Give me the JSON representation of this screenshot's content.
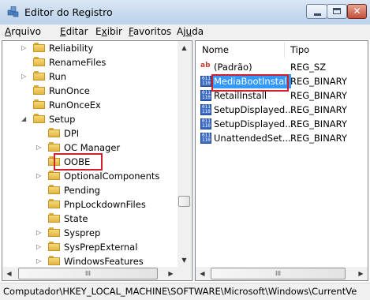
{
  "window": {
    "title": "Editor do Registro"
  },
  "menu": [
    {
      "label": "Arquivo",
      "underline": "A",
      "rest": "rquivo"
    },
    {
      "label": "Editar",
      "underline": "E",
      "rest": "ditar"
    },
    {
      "label": "Exibir",
      "underline": "x",
      "pre": "E",
      "rest": "ibir"
    },
    {
      "label": "Favoritos",
      "underline": "F",
      "rest": "avoritos"
    },
    {
      "label": "Ajuda",
      "underline": "u",
      "pre": "Aj",
      "rest": "da"
    }
  ],
  "tree": [
    {
      "label": "Reliability",
      "expander": "closed"
    },
    {
      "label": "RenameFiles",
      "expander": "none"
    },
    {
      "label": "Run",
      "expander": "closed"
    },
    {
      "label": "RunOnce",
      "expander": "none"
    },
    {
      "label": "RunOnceEx",
      "expander": "none"
    },
    {
      "label": "Setup",
      "expander": "open"
    },
    {
      "label": "DPI",
      "expander": "none"
    },
    {
      "label": "OC Manager",
      "expander": "closed"
    },
    {
      "label": "OOBE",
      "expander": "none",
      "highlighted": true
    },
    {
      "label": "OptionalComponents",
      "expander": "closed"
    },
    {
      "label": "Pending",
      "expander": "none"
    },
    {
      "label": "PnpLockdownFiles",
      "expander": "none"
    },
    {
      "label": "State",
      "expander": "none"
    },
    {
      "label": "Sysprep",
      "expander": "closed"
    },
    {
      "label": "SysPrepExternal",
      "expander": "closed"
    },
    {
      "label": "WindowsFeatures",
      "expander": "closed"
    }
  ],
  "list": {
    "columns": {
      "name": "Nome",
      "type": "Tipo"
    },
    "rows": [
      {
        "name": "(Padrão)",
        "type": "REG_SZ",
        "icon": "string-value-icon"
      },
      {
        "name": "MediaBootInstall",
        "type": "REG_BINARY",
        "icon": "binary-value-icon",
        "selected": true
      },
      {
        "name": "RetailInstall",
        "type": "REG_BINARY",
        "icon": "binary-value-icon"
      },
      {
        "name": "SetupDisplayed...",
        "type": "REG_BINARY",
        "icon": "binary-value-icon"
      },
      {
        "name": "SetupDisplayed...",
        "type": "REG_BINARY",
        "icon": "binary-value-icon"
      },
      {
        "name": "UnattendedSet...",
        "type": "REG_BINARY",
        "icon": "binary-value-icon"
      }
    ]
  },
  "scrollbar": {
    "grip": "III"
  },
  "statusbar": {
    "path": "Computador\\HKEY_LOCAL_MACHINE\\SOFTWARE\\Microsoft\\Windows\\CurrentVe"
  },
  "colors": {
    "highlight_box": "#d0202e",
    "selection": "#3399ff"
  }
}
